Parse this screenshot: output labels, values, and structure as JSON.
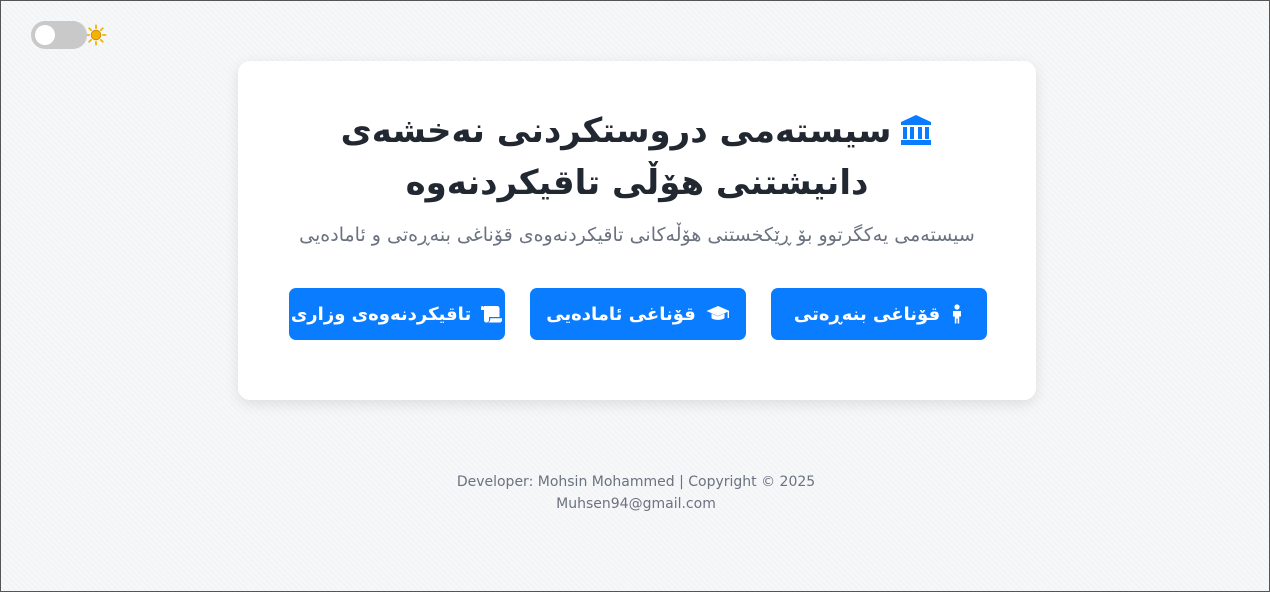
{
  "theme_toggle": {
    "icon": "sun-icon",
    "state": "light"
  },
  "header": {
    "icon": "bank-icon",
    "title": "سیستەمی دروستکردنی نەخشەی دانیشتنی هۆڵی تاقیکردنەوە",
    "subtitle": "سیستەمی یەکگرتوو بۆ ڕێکخستنی هۆڵەکانی تاقیکردنەوەی قۆناغی بنەڕەتی و ئامادەیی"
  },
  "buttons": [
    {
      "label": "قۆناغی بنەڕەتی",
      "icon": "child-icon"
    },
    {
      "label": "قۆناغی ئامادەیی",
      "icon": "graduation-cap-icon"
    },
    {
      "label": "تاقیکردنەوەی وزاری",
      "icon": "scroll-icon"
    }
  ],
  "footer": {
    "line1": "Developer: Mohsin Mohammed | Copyright © 2025",
    "line2": "Muhsen94@gmail.com"
  },
  "colors": {
    "accent": "#0a7cff",
    "title": "#222831",
    "muted": "#6b7280",
    "toggle_track": "#c9c9c9",
    "sun": "#f5b301"
  }
}
